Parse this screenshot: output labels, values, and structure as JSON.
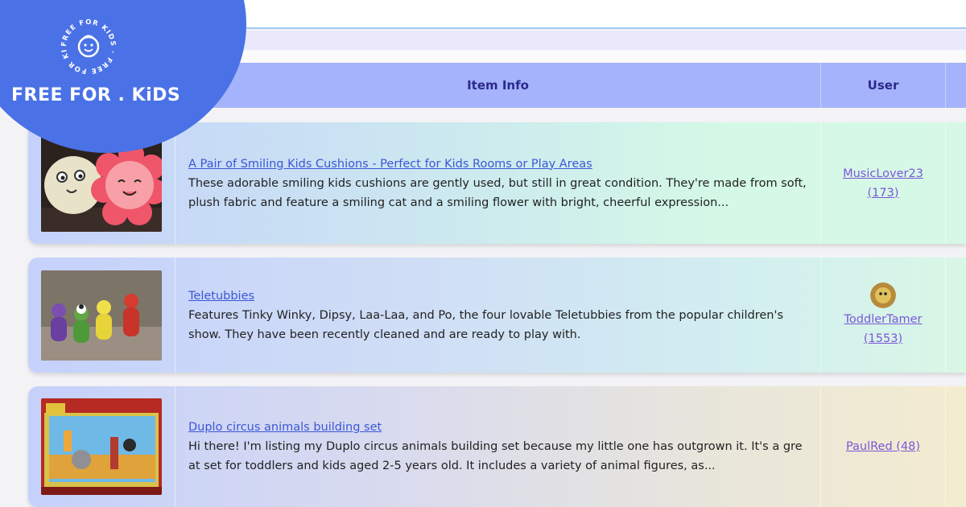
{
  "brand": {
    "name": "FREE FOR . KiDS",
    "badge_text": "FREE FOR KIDS · FREE FOR KIDS ·",
    "color": "#4a71e6"
  },
  "table": {
    "headers": {
      "item_info": "Item Info",
      "user": "User"
    }
  },
  "items": [
    {
      "title": "A Pair of Smiling Kids Cushions - Perfect for Kids Rooms or Play Areas",
      "description": "These adorable smiling kids cushions are gently used, but still in great condition. They're made from soft, plush fabric and feature a smiling cat and a smiling flower with bright, cheerful expression...",
      "user": "MusicLover23",
      "user_count": "(173)",
      "image": "cushions-photo"
    },
    {
      "title": "Teletubbies",
      "description": "Features Tinky Winky, Dipsy, Laa-Laa, and Po, the four lovable Teletubbies from the popular children's show. They have been recently cleaned and are ready to play with.",
      "user": "ToddlerTamer",
      "user_count": "(1553)",
      "image": "teletubbies-photo",
      "avatar": "user-avatar"
    },
    {
      "title": "Duplo circus animals building set",
      "description": "Hi there! I'm listing my Duplo circus animals building set because my little one has outgrown it. It's a great set for toddlers and kids aged 2-5 years old. It includes a variety of animal figures, as...",
      "user": "PaulRed (48)",
      "image": "duplo-box-photo"
    }
  ]
}
